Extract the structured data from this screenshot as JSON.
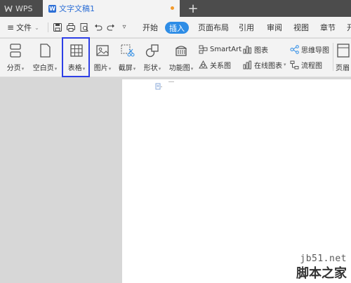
{
  "titlebar": {
    "app_tab_label": "WPS",
    "doc_tab_label": "文字文稿1",
    "new_tab_symbol": "+"
  },
  "menubar": {
    "file_menu_label": "文件",
    "tabs": [
      {
        "label": "开始"
      },
      {
        "label": "插入"
      },
      {
        "label": "页面布局"
      },
      {
        "label": "引用"
      },
      {
        "label": "审阅"
      },
      {
        "label": "视图"
      },
      {
        "label": "章节"
      },
      {
        "label": "开"
      }
    ],
    "active_tab_label": "插入",
    "accent_color": "#2e8de6"
  },
  "ribbon": {
    "buttons": {
      "page_break": "分页",
      "blank_page": "空白页",
      "table": "表格",
      "picture": "图片",
      "screenshot": "截屏",
      "shape": "形状",
      "function_chart": "功能图"
    },
    "small_buttons": {
      "smartart": "SmartArt",
      "chart": "图表",
      "mind_map": "思维导图",
      "relation": "关系图",
      "online_chart": "在线图表",
      "flowchart": "流程图"
    },
    "header_footer": "页眉"
  },
  "watermark": {
    "url": "jb51.net",
    "name": "脚本之家"
  }
}
